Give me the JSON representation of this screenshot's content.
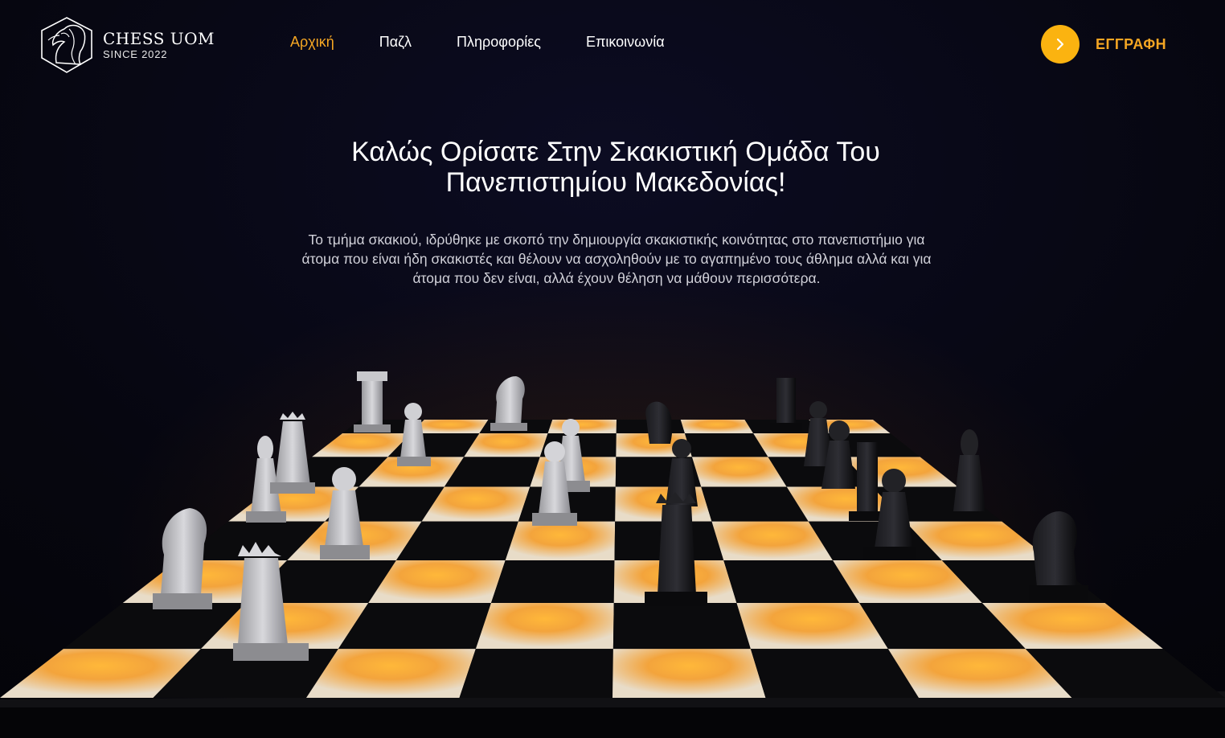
{
  "header": {
    "logo": {
      "title": "CHESS UOM",
      "subtitle": "SINCE 2022",
      "icon": "knight-logo-icon"
    },
    "nav": [
      {
        "label": "Αρχική",
        "active": true
      },
      {
        "label": "Παζλ",
        "active": false
      },
      {
        "label": "Πληροφορίες",
        "active": false
      },
      {
        "label": "Επικοινωνία",
        "active": false
      }
    ],
    "signup": {
      "label": "ΕΓΓΡΑΦΗ",
      "icon": "chevron-right-icon"
    }
  },
  "hero": {
    "title_line1": "Καλώς Ορίσατε Στην Σκακιστική Ομάδα Του",
    "title_line2": "Πανεπιστημίου Μακεδονίας!",
    "body": "Το τμήμα σκακιού, ιδρύθηκε με σκοπό την δημιουργία σκακιστικής κοινότητας στο πανεπιστήμιο για άτομα που είναι ήδη σκακιστές και θέλουν να ασχοληθούν με το αγαπημένο τους άθλημα αλλά και για άτομα που δεν είναι, αλλά έχουν θέληση να μάθουν περισσότερα."
  },
  "image": {
    "name": "chessboard-3d-illustration"
  },
  "colors": {
    "accent": "#f5a623",
    "button": "#fbb310",
    "background": "#06060c"
  }
}
